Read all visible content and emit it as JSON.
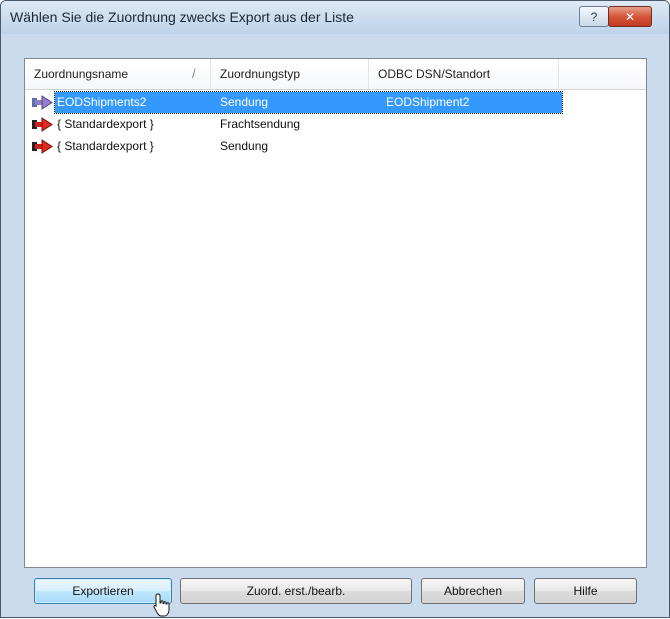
{
  "window": {
    "title": "Wählen Sie die Zuordnung zwecks Export aus der Liste",
    "help_label": "?",
    "close_label": "✕"
  },
  "listview": {
    "columns": [
      "Zuordnungsname",
      "Zuordnungstyp",
      "ODBC DSN/Standort",
      ""
    ],
    "sort_indicator": "/",
    "rows": [
      {
        "name": "EODShipments2",
        "type": "Sendung",
        "dsn": "EODShipment2",
        "selected": true,
        "icon": "mapping-arrow-icon"
      },
      {
        "name": "{ Standardexport }",
        "type": "Frachtsendung",
        "dsn": "",
        "selected": false,
        "icon": "default-mapping-icon"
      },
      {
        "name": "{ Standardexport }",
        "type": "Sendung",
        "dsn": "",
        "selected": false,
        "icon": "default-mapping-icon"
      }
    ]
  },
  "buttons": {
    "export": "Exportieren",
    "edit": "Zuord. erst./bearb.",
    "cancel": "Abbrechen",
    "help": "Hilfe"
  },
  "colors": {
    "selection": "#3399ff",
    "accent_red": "#d0201a"
  }
}
